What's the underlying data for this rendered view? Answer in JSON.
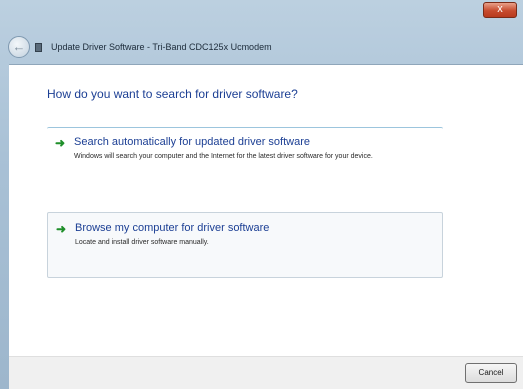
{
  "window": {
    "close_label": "x"
  },
  "header": {
    "back_icon": "back-arrow-icon",
    "device_icon": "modem-icon",
    "title": "Update Driver Software - Tri-Band CDC125x Ucmodem"
  },
  "content": {
    "question": "How do you want to search for driver software?",
    "options": [
      {
        "icon": "green-arrow-icon",
        "title": "Search automatically for updated driver software",
        "description": "Windows will search your computer and the Internet for the latest driver software for your device."
      },
      {
        "icon": "green-arrow-icon",
        "title": "Browse my computer for driver software",
        "description": "Locate and install driver software manually."
      }
    ]
  },
  "footer": {
    "cancel_label": "Cancel"
  },
  "colors": {
    "link_blue": "#1c3f94",
    "arrow_green": "#1f8f2a",
    "close_red": "#c74b2e"
  }
}
